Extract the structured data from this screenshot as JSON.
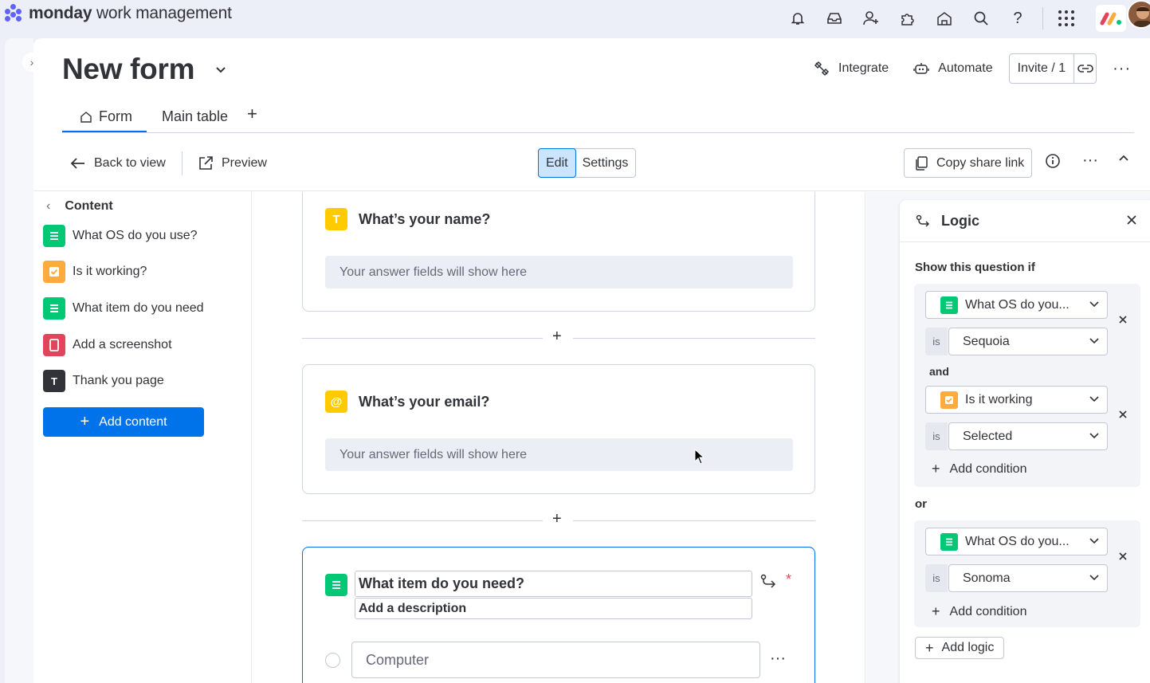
{
  "app": {
    "brand_bold": "monday",
    "brand_rest": " work management"
  },
  "colors": {
    "accent": "#0073ea",
    "green": "#00c875",
    "orange": "#fdab3d",
    "yellow": "#ffcb00",
    "red": "#e2445c",
    "dark": "#323338"
  },
  "page": {
    "title": "New form"
  },
  "header_actions": {
    "integrate": "Integrate",
    "automate": "Automate",
    "invite": "Invite / 1"
  },
  "tabs": [
    {
      "label": "Form"
    },
    {
      "label": "Main table"
    }
  ],
  "toolbar": {
    "back": "Back to view",
    "preview": "Preview",
    "edit": "Edit",
    "settings": "Settings",
    "copy_link": "Copy share link"
  },
  "sidebar": {
    "header": "Content",
    "items": [
      {
        "label": "What OS do you use?",
        "icon": "dropdown-icon",
        "color": "#00c875"
      },
      {
        "label": "Is it working?",
        "icon": "checkbox-icon",
        "color": "#fdab3d"
      },
      {
        "label": "What item do you need",
        "icon": "dropdown-icon",
        "color": "#00c875"
      },
      {
        "label": "Add a screenshot",
        "icon": "file-icon",
        "color": "#e2445c"
      },
      {
        "label": "Thank you page",
        "icon": "text-icon",
        "color": "#323338",
        "glyph": "T"
      }
    ],
    "add_button": "Add content"
  },
  "questions": [
    {
      "title": "What’s your name?",
      "icon_glyph": "T",
      "placeholder": "Your answer fields will show here",
      "color": "#ffcb00"
    },
    {
      "title": "What’s your email?",
      "icon_glyph": "@",
      "placeholder": "Your answer fields will show here",
      "color": "#ffcb00"
    }
  ],
  "active_question": {
    "title": "What item do you need?",
    "description": "Add a description",
    "required_mark": "*",
    "option_1": "Computer"
  },
  "logic": {
    "title": "Logic",
    "show_if": "Show this question if",
    "is_label": "is",
    "and_label": "and",
    "or_label": "or",
    "group1": {
      "cond1_question": "What OS do you...",
      "cond1_value": "Sequoia",
      "cond2_question": "Is it working",
      "cond2_value": "Selected",
      "add_condition": "Add condition"
    },
    "group2": {
      "cond1_question": "What OS do you...",
      "cond1_value": "Sonoma",
      "add_condition": "Add condition"
    },
    "add_logic": "Add logic"
  }
}
